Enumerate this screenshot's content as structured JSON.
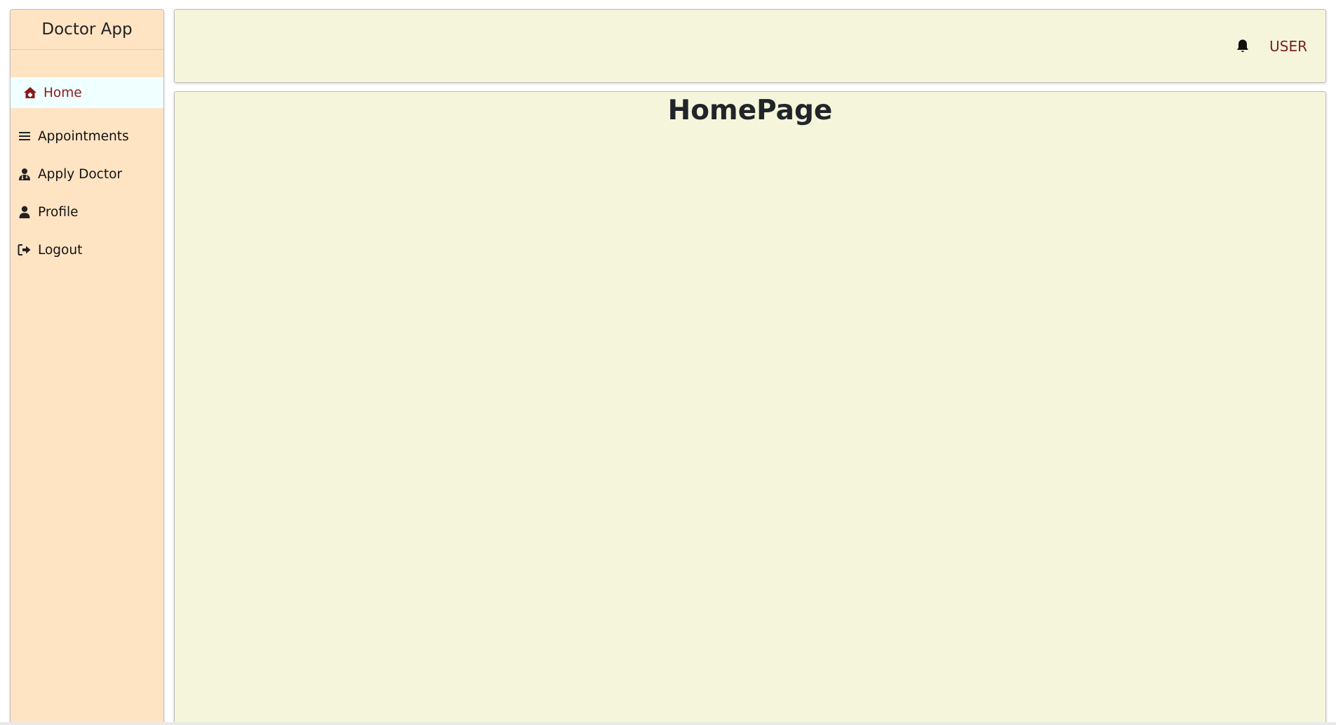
{
  "sidebar": {
    "brand": "Doctor App",
    "items": [
      {
        "label": "Home",
        "icon": "home-icon",
        "active": true
      },
      {
        "label": "Appointments",
        "icon": "list-icon",
        "active": false
      },
      {
        "label": "Apply Doctor",
        "icon": "doctor-icon",
        "active": false
      },
      {
        "label": "Profile",
        "icon": "user-icon",
        "active": false
      },
      {
        "label": "Logout",
        "icon": "logout-icon",
        "active": false
      }
    ]
  },
  "header": {
    "notification_icon": "bell-icon",
    "user_label": "USER"
  },
  "main": {
    "title": "HomePage"
  },
  "colors": {
    "sidebar_bg": "#ffe4c4",
    "active_item_bg": "#f0ffff",
    "active_item_text": "#8b1a1a",
    "panel_bg": "#f5f5dc",
    "user_link": "#7a1f1f"
  }
}
